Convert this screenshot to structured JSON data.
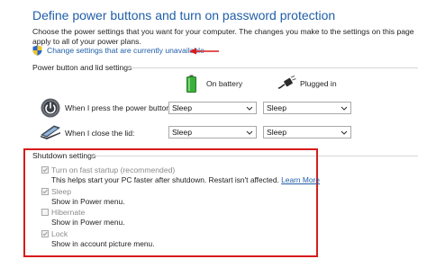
{
  "header": {
    "title": "Define power buttons and turn on password protection",
    "description": "Choose the power settings that you want for your computer. The changes you make to the settings on this page apply to all of your power plans.",
    "change_link": "Change settings that are currently unavailable"
  },
  "power_section": {
    "label": "Power button and lid settings",
    "columns": [
      "On battery",
      "Plugged in"
    ],
    "rows": [
      {
        "label": "When I press the power button:",
        "battery": "Sleep",
        "plugged": "Sleep"
      },
      {
        "label": "When I close the lid:",
        "battery": "Sleep",
        "plugged": "Sleep"
      }
    ]
  },
  "shutdown": {
    "label": "Shutdown settings",
    "options": [
      {
        "title": "Turn on fast startup (recommended)",
        "desc": "This helps start your PC faster after shutdown. Restart isn't affected.",
        "link": "Learn More",
        "checked": true
      },
      {
        "title": "Sleep",
        "desc": "Show in Power menu.",
        "checked": true
      },
      {
        "title": "Hibernate",
        "desc": "Show in Power menu.",
        "checked": false
      },
      {
        "title": "Lock",
        "desc": "Show in account picture menu.",
        "checked": true
      }
    ]
  },
  "colors": {
    "title_blue": "#1f5ea8",
    "highlight_red": "#d81b1b",
    "battery_green": "#3cae3c"
  }
}
